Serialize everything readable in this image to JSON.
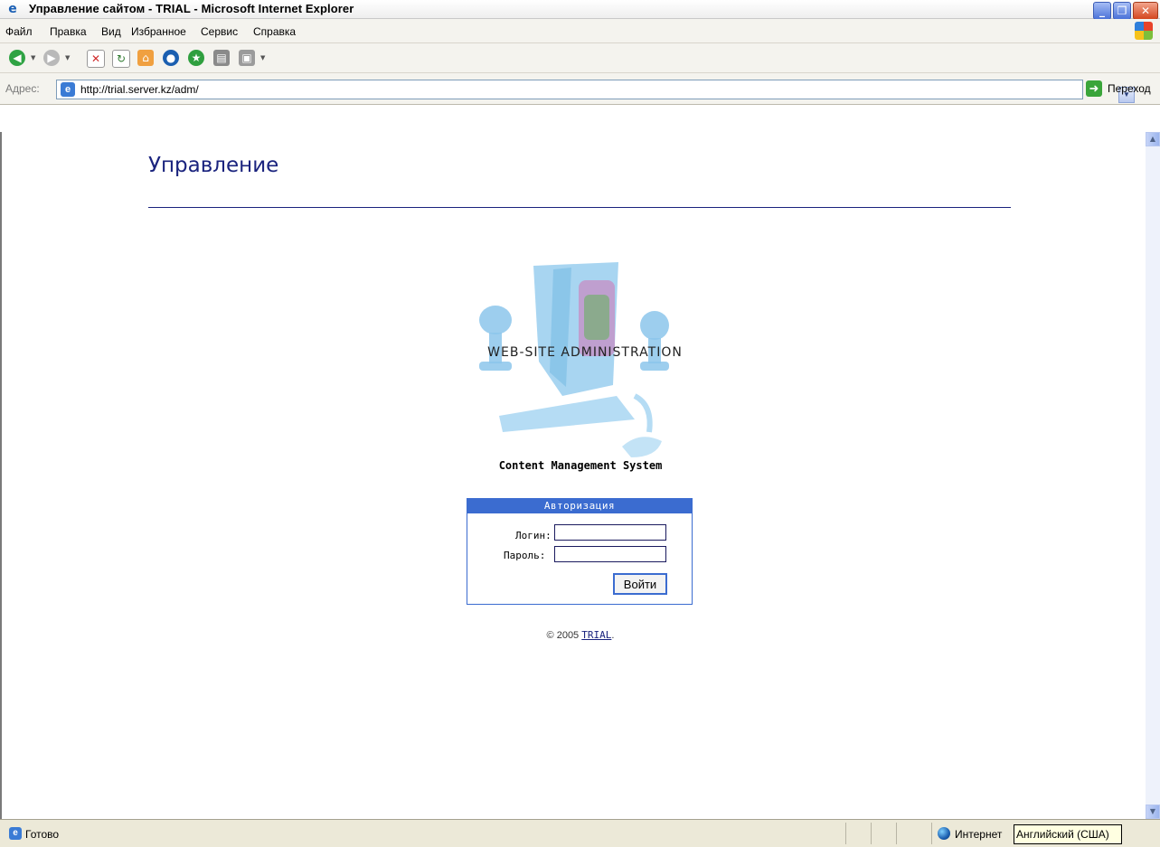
{
  "window": {
    "title": "Управление сайтом - TRIAL - Microsoft Internet Explorer",
    "min_glyph": "_",
    "max_glyph": "❐",
    "close_glyph": "✕"
  },
  "menu": {
    "items": [
      "Файл",
      "Правка",
      "Вид",
      "Избранное",
      "Сервис",
      "Справка"
    ]
  },
  "toolbar": {
    "icons": [
      "back-icon",
      "forward-icon",
      "stop-icon",
      "refresh-icon",
      "home-icon",
      "search-icon",
      "favorites-icon",
      "print-icon",
      "edit-icon"
    ]
  },
  "address": {
    "label": "Адрес:",
    "url": "http://trial.server.kz/adm/",
    "go_label": "Переход"
  },
  "page": {
    "title": "Управление",
    "logo_text": "WEB-SITE ADMINISTRATION",
    "cms_label": "Content Management System",
    "auth": {
      "header": "Авторизация",
      "login_label": "Логин:",
      "login_value": "",
      "password_label": "Пароль:",
      "password_value": "",
      "submit_label": "Войти"
    },
    "footer": {
      "copyright": "© 2005",
      "link_text": "TRIAL",
      "trailing": "."
    }
  },
  "status": {
    "text": "Готово",
    "zone": "Интернет",
    "language_tooltip": "Английский (США)"
  },
  "colors": {
    "title_blue": "#1a237e",
    "auth_blue": "#3b6cd0"
  }
}
